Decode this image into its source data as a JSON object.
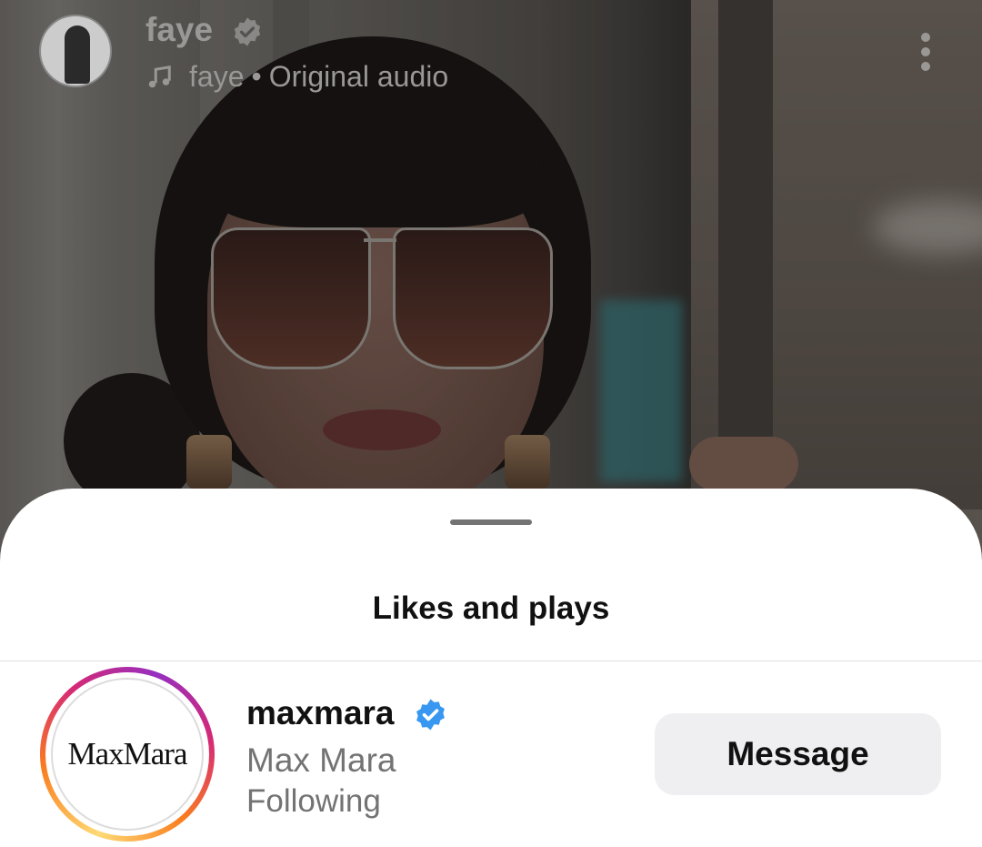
{
  "reel": {
    "username": "faye",
    "audio_owner": "faye",
    "audio_separator": "•",
    "audio_label": "Original audio"
  },
  "sheet": {
    "title": "Likes and plays"
  },
  "accounts": [
    {
      "username": "maxmara",
      "logo_text": "MaxMara",
      "full_name": "Max Mara",
      "status": "Following",
      "button_label": "Message"
    }
  ],
  "colors": {
    "verified": "#3897f0",
    "button_bg": "#efeff1",
    "secondary_text": "#737373"
  },
  "icons": [
    "verified-badge-icon",
    "music-note-icon",
    "more-options-icon"
  ]
}
